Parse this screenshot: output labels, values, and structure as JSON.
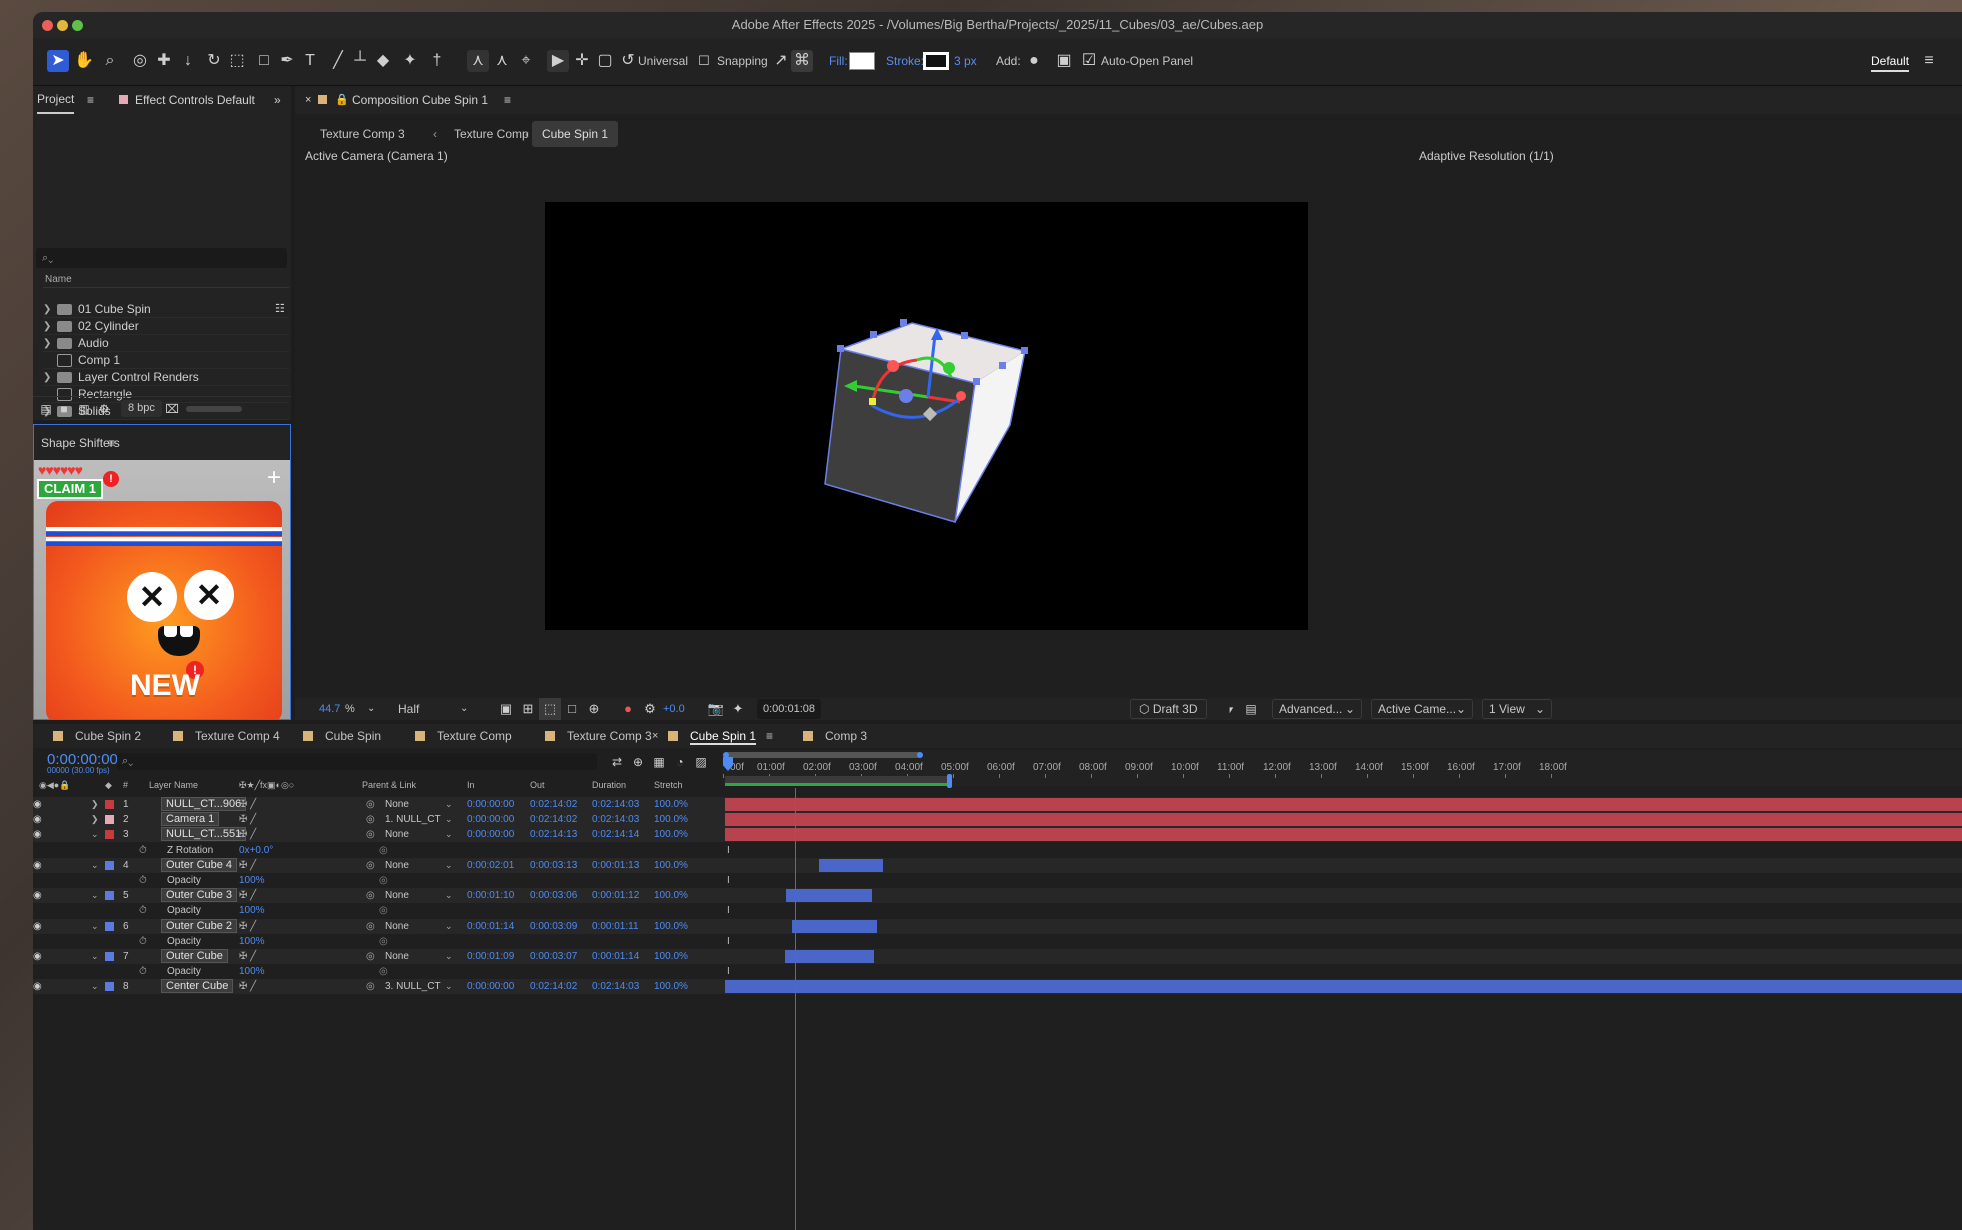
{
  "app": {
    "title": "Adobe After Effects 2025 - /Volumes/Big Bertha/Projects/_2025/11_Cubes/03_ae/Cubes.aep"
  },
  "colors": {
    "accent": "#2f5bd4",
    "timeline_blue": "#4e8cf3",
    "layer_red": "#b8434f",
    "bar_blue": "#4a66c8"
  },
  "toolbar": {
    "axis_mode": "Universal",
    "snapping": "Snapping",
    "fill_label": "Fill:",
    "stroke_label": "Stroke:",
    "stroke_width": "3 px",
    "add_label": "Add:",
    "auto_open": "Auto-Open Panel",
    "workspace": "Default"
  },
  "project": {
    "tab_project": "Project",
    "tab_effects": "Effect Controls Default",
    "search_placeholder": "",
    "name_header": "Name",
    "bpc": "8 bpc",
    "items": [
      {
        "label": "01 Cube Spin",
        "type": "folder"
      },
      {
        "label": "02 Cylinder",
        "type": "folder"
      },
      {
        "label": "Audio",
        "type": "folder"
      },
      {
        "label": "Comp 1",
        "type": "comp"
      },
      {
        "label": "Layer Control Renders",
        "type": "folder"
      },
      {
        "label": "Rectangle",
        "type": "comp"
      },
      {
        "label": "Solids",
        "type": "folder"
      }
    ]
  },
  "shapeshifters": {
    "title": "Shape Shifters",
    "claim": "CLAIM",
    "claim_count": "1",
    "new_badge": "NEW"
  },
  "comp": {
    "tab_title": "Composition Cube Spin 1",
    "breadcrumbs": [
      "Texture Comp 3",
      "Texture Comp",
      "Cube Spin 1"
    ],
    "camera_label": "Active Camera (Camera 1)",
    "resolution_label": "Adaptive Resolution (1/1)"
  },
  "viewer_bottom": {
    "zoom": "44.7",
    "zoom_unit": "%",
    "quality": "Half",
    "exposure": "+0.0",
    "timecode": "0:00:01:08",
    "renderer": "Draft 3D",
    "advanced": "Advanced...",
    "camera": "Active Came...",
    "views": "1 View"
  },
  "timeline": {
    "tabs": [
      "Cube Spin 2",
      "Texture Comp 4",
      "Cube Spin",
      "Texture Comp",
      "Texture Comp 3",
      "Cube Spin 1",
      "Comp 3"
    ],
    "active_tab": "Cube Spin 1",
    "timecode": "0:00:00:00",
    "fps_note": "00000 (30.00 fps)",
    "ruler": [
      "00f",
      "01:00f",
      "02:00f",
      "03:00f",
      "04:00f",
      "05:00f",
      "06:00f",
      "07:00f",
      "08:00f",
      "09:00f",
      "10:00f",
      "11:00f",
      "12:00f",
      "13:00f",
      "14:00f",
      "15:00f",
      "16:00f",
      "17:00f",
      "18:00f"
    ],
    "columns": {
      "num": "#",
      "layer_name": "Layer Name",
      "parent": "Parent & Link",
      "in": "In",
      "out": "Out",
      "duration": "Duration",
      "stretch": "Stretch"
    },
    "rows": [
      {
        "kind": "layer",
        "num": "1",
        "name": "NULL_CT...906",
        "parent": "None",
        "in": "0:00:00:00",
        "out": "0:02:14:02",
        "duration": "0:02:14:03",
        "stretch": "100.0%",
        "label_color": "#c63b3b"
      },
      {
        "kind": "layer",
        "num": "2",
        "name": "Camera 1",
        "parent": "1. NULL_CT",
        "in": "0:00:00:00",
        "out": "0:02:14:02",
        "duration": "0:02:14:03",
        "stretch": "100.0%",
        "label_color": "#e8a9b6"
      },
      {
        "kind": "layer",
        "num": "3",
        "name": "NULL_CT...551",
        "parent": "None",
        "in": "0:00:00:00",
        "out": "0:02:14:13",
        "duration": "0:02:14:14",
        "stretch": "100.0%",
        "label_color": "#c63b3b"
      },
      {
        "kind": "prop",
        "name": "Z Rotation",
        "value": "0x+0.0°"
      },
      {
        "kind": "layer",
        "num": "4",
        "name": "Outer Cube 4",
        "parent": "None",
        "in": "0:00:02:01",
        "out": "0:00:03:13",
        "duration": "0:00:01:13",
        "stretch": "100.0%",
        "label_color": "#5b7be0"
      },
      {
        "kind": "prop",
        "name": "Opacity",
        "value": "100%"
      },
      {
        "kind": "layer",
        "num": "5",
        "name": "Outer Cube 3",
        "parent": "None",
        "in": "0:00:01:10",
        "out": "0:00:03:06",
        "duration": "0:00:01:12",
        "stretch": "100.0%",
        "label_color": "#5b7be0"
      },
      {
        "kind": "prop",
        "name": "Opacity",
        "value": "100%"
      },
      {
        "kind": "layer",
        "num": "6",
        "name": "Outer Cube 2",
        "parent": "None",
        "in": "0:00:01:14",
        "out": "0:00:03:09",
        "duration": "0:00:01:11",
        "stretch": "100.0%",
        "label_color": "#5b7be0"
      },
      {
        "kind": "prop",
        "name": "Opacity",
        "value": "100%"
      },
      {
        "kind": "layer",
        "num": "7",
        "name": "Outer Cube",
        "parent": "None",
        "in": "0:00:01:09",
        "out": "0:00:03:07",
        "duration": "0:00:01:14",
        "stretch": "100.0%",
        "label_color": "#5b7be0"
      },
      {
        "kind": "prop",
        "name": "Opacity",
        "value": "100%"
      },
      {
        "kind": "layer",
        "num": "8",
        "name": "Center Cube",
        "parent": "3. NULL_CT",
        "in": "0:00:00:00",
        "out": "0:02:14:02",
        "duration": "0:02:14:03",
        "stretch": "100.0%",
        "label_color": "#5b7be0"
      }
    ]
  }
}
